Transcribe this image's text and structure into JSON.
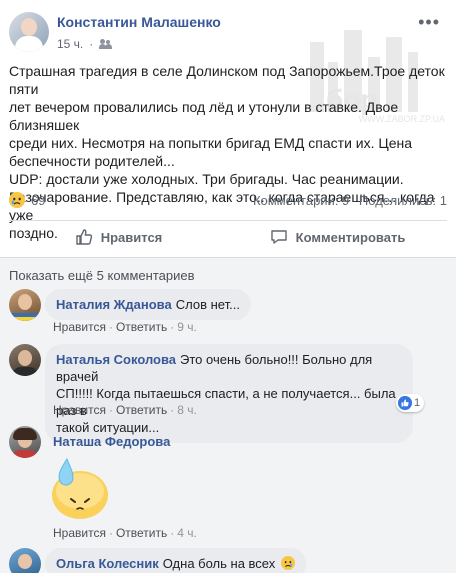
{
  "post": {
    "author": "Константин Малашенко",
    "time": "15 ч.",
    "audience_icon": "friends-icon",
    "more_icon": "more-dots-icon",
    "watermark_url": "WWW.ZABOR.ZP.UA",
    "text": "Страшная трагедия в селе Долинском под Запорожьем.Трое деток пяти\nлет вечером провалились под лёд и утонули в ставке. Двое близняшек\nсреди них. Несмотря на попытки бригад ЕМД спасти их. Цена\nбеспечности родителей...\nUDP: достали уже холодных. Три бригады. Час реанимации.\nРазочарование. Представляю, как это...когда стараешься... когда уже\nпоздно.",
    "reaction_icon": "sad-emoji-icon",
    "reaction_count": "69",
    "comments_count": "Комментарии: 9",
    "shares_count": "Поделились: 1",
    "like_label": "Нравится",
    "comment_label": "Комментировать"
  },
  "comments": {
    "show_more": "Показать ещё 5 комментариев",
    "items": [
      {
        "name": "Наталия Жданова",
        "text": "Слов нет...",
        "like": "Нравится",
        "reply": "Ответить",
        "time": "9 ч."
      },
      {
        "name": "Наталья Соколова",
        "text_line1": "Это очень больно!!! Больно для врачей",
        "text_line2": "СП!!!!! Когда пытаешься спасти, а не получается... была раз в",
        "text_line3": "такой ситуации...",
        "like": "Нравится",
        "reply": "Ответить",
        "time": "8 ч.",
        "likes": "1"
      },
      {
        "name": "Наташа Федорова",
        "sticker": "sad-sweat-sticker",
        "like": "Нравится",
        "reply": "Ответить",
        "time": "4 ч."
      },
      {
        "name": "Ольга Колесник",
        "text": "Одна боль на всех"
      }
    ]
  },
  "colors": {
    "link_blue": "#385898",
    "meta_gray": "#606770",
    "bubble_bg": "#e9ebee",
    "comments_bg": "#f2f3f5"
  }
}
